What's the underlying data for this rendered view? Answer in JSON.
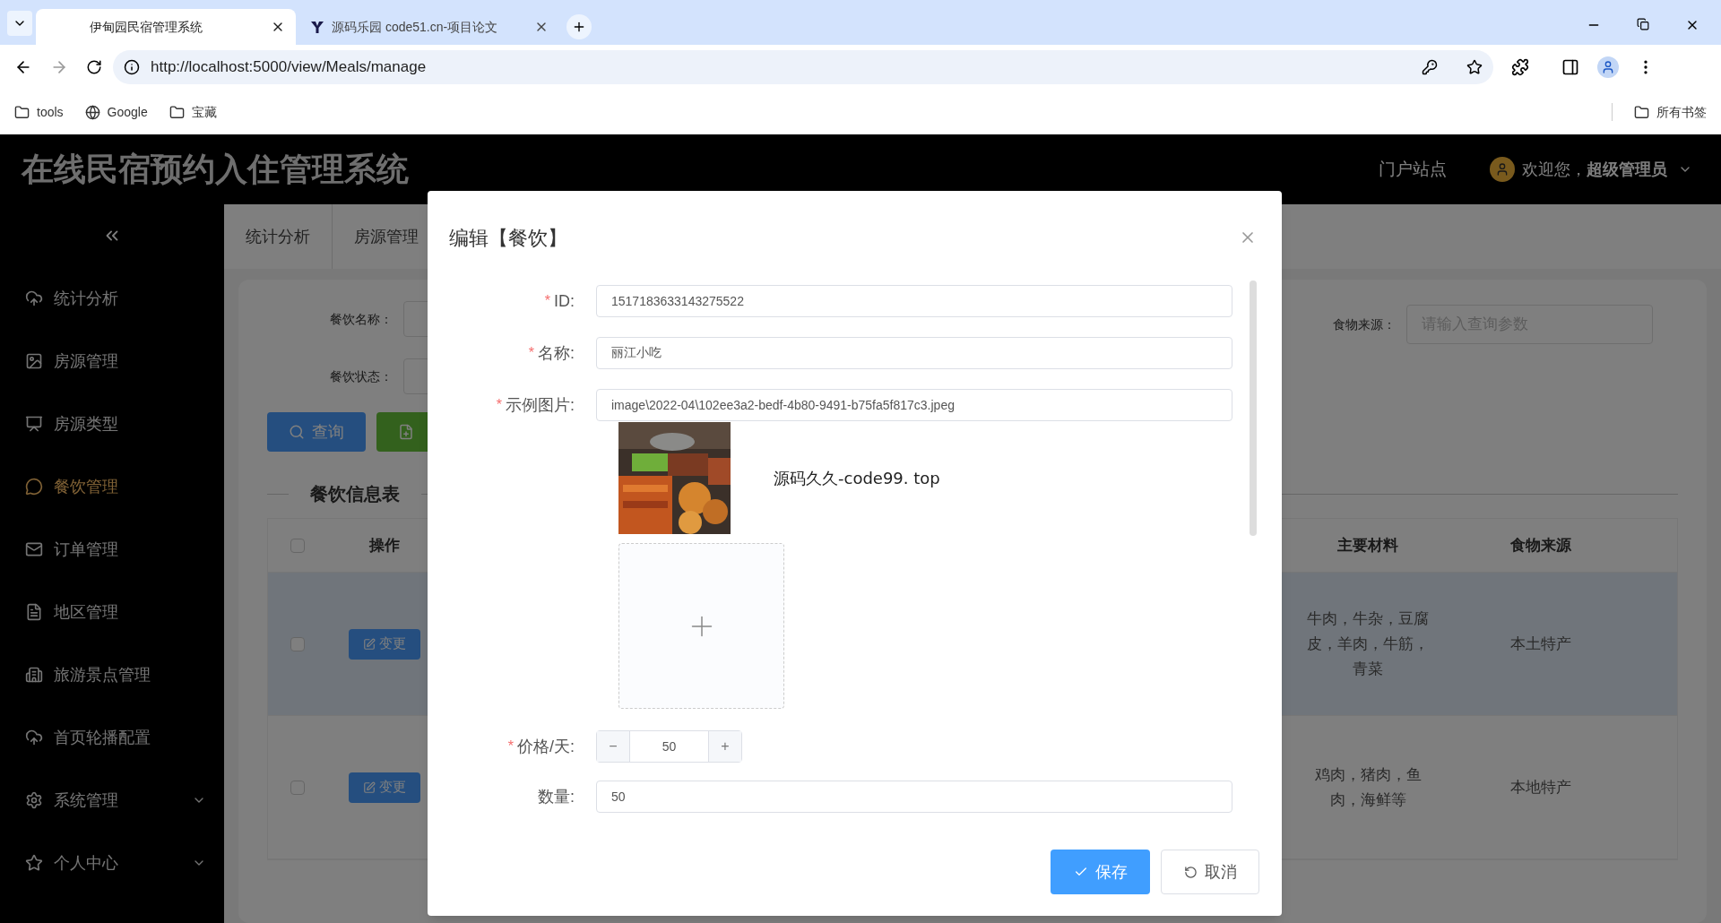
{
  "browser": {
    "tabs": [
      {
        "title": "伊甸园民宿管理系统",
        "selected": true
      },
      {
        "title": "源码乐园 code51.cn-项目论文",
        "selected": false
      }
    ],
    "url": "http://localhost:5000/view/Meals/manage",
    "bookmarks": [
      {
        "label": "tools",
        "kind": "folder"
      },
      {
        "label": "Google",
        "kind": "globe"
      },
      {
        "label": "宝藏",
        "kind": "folder"
      }
    ],
    "all_bookmarks": "所有书签"
  },
  "header": {
    "title": "在线民宿预约入住管理系统",
    "portal_link": "门户站点",
    "welcome": "欢迎您，",
    "user": "超级管理员"
  },
  "sidebar": {
    "items": [
      {
        "label": "统计分析",
        "selected": false,
        "expandable": false
      },
      {
        "label": "房源管理",
        "selected": false,
        "expandable": false
      },
      {
        "label": "房源类型",
        "selected": false,
        "expandable": false
      },
      {
        "label": "餐饮管理",
        "selected": true,
        "expandable": false
      },
      {
        "label": "订单管理",
        "selected": false,
        "expandable": false
      },
      {
        "label": "地区管理",
        "selected": false,
        "expandable": false
      },
      {
        "label": "旅游景点管理",
        "selected": false,
        "expandable": false
      },
      {
        "label": "首页轮播配置",
        "selected": false,
        "expandable": false
      },
      {
        "label": "系统管理",
        "selected": false,
        "expandable": true
      },
      {
        "label": "个人中心",
        "selected": false,
        "expandable": true
      }
    ]
  },
  "page_tabs": [
    "统计分析",
    "房源管理"
  ],
  "search": {
    "fields_left": [
      "餐饮名称：",
      "餐饮状态："
    ],
    "source_label": "食物来源：",
    "source_placeholder": "请输入查询参数",
    "query_button": "查询"
  },
  "table": {
    "title": "餐饮信息表",
    "columns": [
      "操作",
      "主要材料",
      "食物来源"
    ],
    "header_checked": false,
    "rows": [
      {
        "selected": true,
        "checked": false,
        "action": "变更",
        "materials": "牛肉，牛杂，豆腐皮，羊肉，牛筋，青菜",
        "source": "本土特产"
      },
      {
        "selected": false,
        "checked": false,
        "action": "变更",
        "materials": "鸡肉，猪肉，鱼肉，海鲜等",
        "source": "本地特产"
      }
    ]
  },
  "dialog": {
    "title": "编辑【餐饮】",
    "required_mark": "*",
    "required": {
      "id": true,
      "name": true,
      "image": true,
      "price": true,
      "quantity": false
    },
    "id_label": "ID:",
    "id_value": "1517183633143275522",
    "name_label": "名称:",
    "name_value": "丽江小吃",
    "image_label": "示例图片:",
    "image_path": "image\\2022-04\\102ee3a2-bedf-4b80-9491-b75fa5f817c3.jpeg",
    "image_caption": "源码久久-code99. top",
    "price_label": "价格/天:",
    "price_value": "50",
    "minus": "−",
    "plus": "+",
    "quantity_label": "数量:",
    "quantity_value": "50",
    "save": "保存",
    "cancel": "取消"
  }
}
